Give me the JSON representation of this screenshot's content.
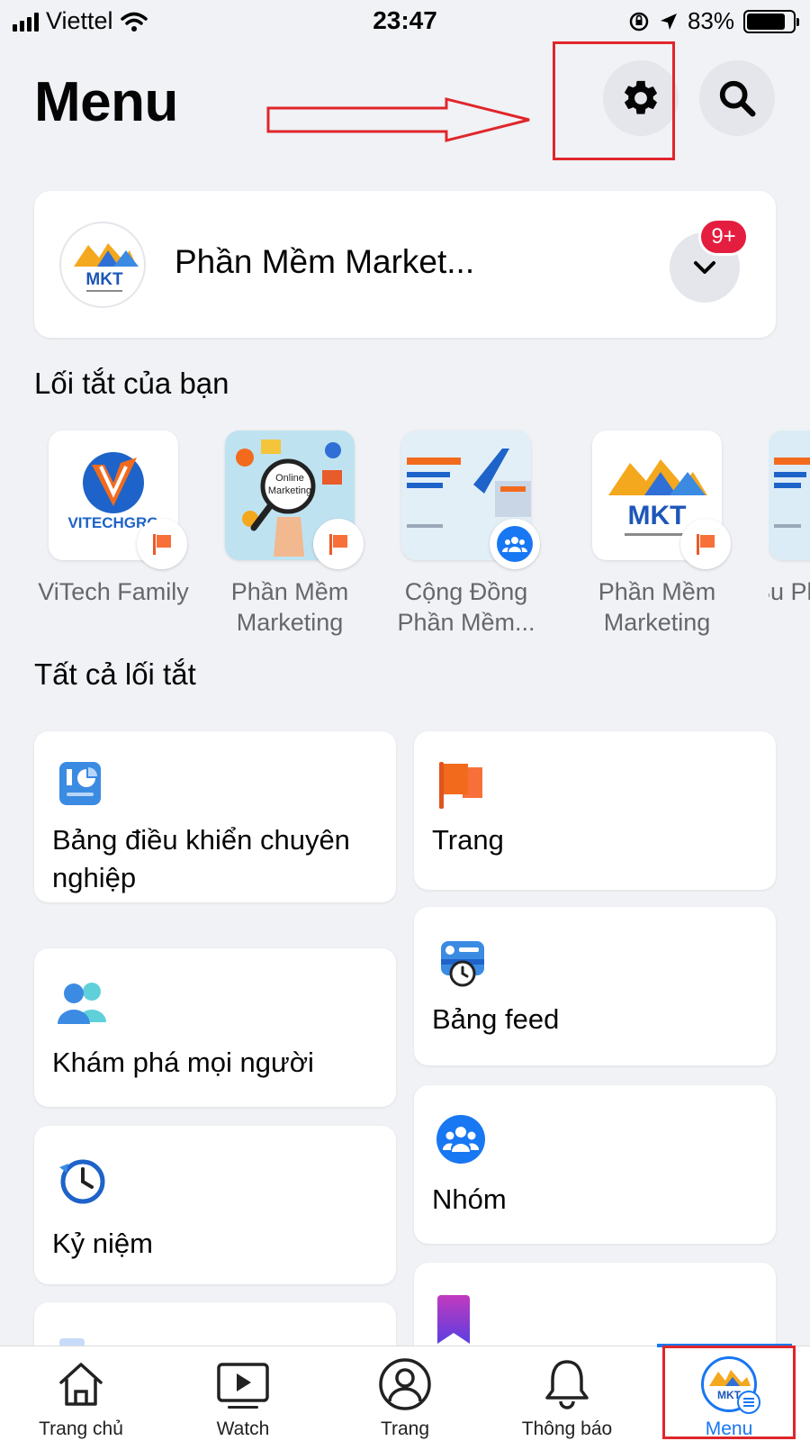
{
  "status_bar": {
    "carrier": "Viettel",
    "time": "23:47",
    "battery": "83%",
    "battery_level": 0.83
  },
  "header": {
    "title": "Menu",
    "settings_icon": "gear-icon",
    "search_icon": "search-icon"
  },
  "profile": {
    "name": "Phần Mềm Market...",
    "badge": "9+",
    "avatar_text": "MKT"
  },
  "shortcuts_section": {
    "title": "Lối tắt của bạn",
    "items": [
      {
        "label": "ViTech Family",
        "badge_icon": "flag-icon"
      },
      {
        "label": "Phần Mềm Marketing",
        "badge_icon": "flag-icon",
        "tile_text": "Online Marketing"
      },
      {
        "label": "Cộng Đồng Phần Mềm...",
        "badge_icon": "group-icon"
      },
      {
        "label": "Phần Mềm Marketing",
        "badge_icon": "flag-icon",
        "tile_text": "MKT"
      },
      {
        "label": "Su Phầ",
        "badge_icon": "flag-icon"
      }
    ]
  },
  "all_shortcuts": {
    "title": "Tất cả lối tắt",
    "left": [
      {
        "label": "Bảng điều khiển chuyên nghiệp",
        "icon": "dashboard-icon"
      },
      {
        "label": "Khám phá mọi người",
        "icon": "people-icon"
      },
      {
        "label": "Kỷ niệm",
        "icon": "memories-clock-icon"
      }
    ],
    "right": [
      {
        "label": "Trang",
        "icon": "flag-icon"
      },
      {
        "label": "Bảng feed",
        "icon": "feed-icon"
      },
      {
        "label": "Nhóm",
        "icon": "groups-icon"
      },
      {
        "label": "",
        "icon": "saved-bookmark-icon"
      }
    ]
  },
  "tab_bar": {
    "tabs": [
      {
        "label": "Trang chủ",
        "icon": "home-icon"
      },
      {
        "label": "Watch",
        "icon": "watch-icon"
      },
      {
        "label": "Trang",
        "icon": "profile-icon"
      },
      {
        "label": "Thông báo",
        "icon": "bell-icon"
      },
      {
        "label": "Menu",
        "icon": "menu-avatar-icon",
        "active": true
      }
    ]
  },
  "colors": {
    "background": "#f0f2f5",
    "accent": "#1877f2",
    "badge": "#e41e3f",
    "annotation": "#e0262b"
  }
}
